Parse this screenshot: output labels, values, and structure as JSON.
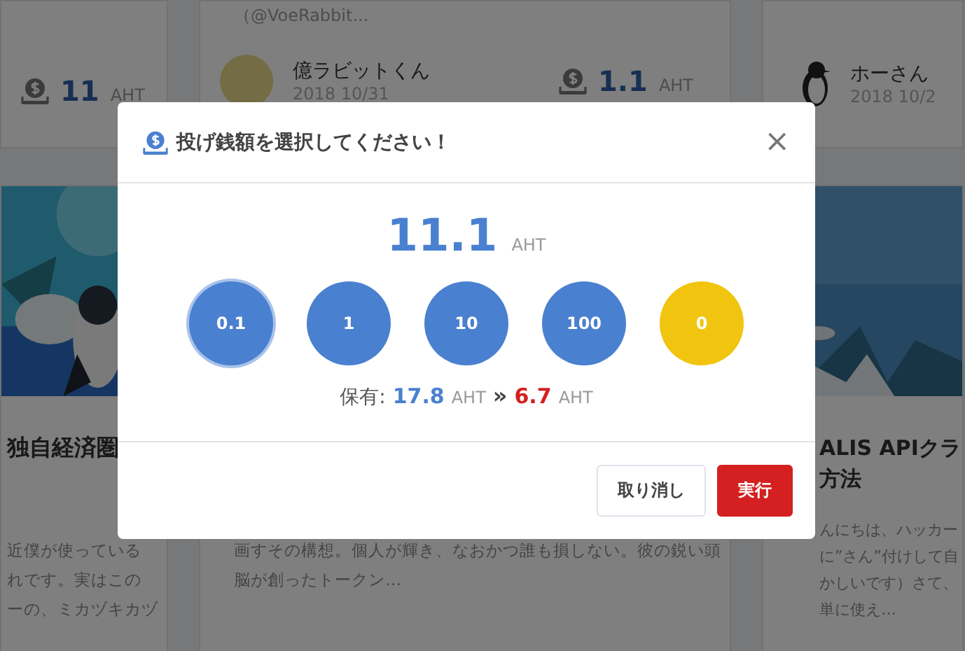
{
  "background": {
    "top_row": [
      {
        "tip": {
          "amount": "11",
          "unit": "AHT"
        }
      },
      {
        "handle": "（@VoeRabbit...",
        "author": {
          "name": "億ラビットくん",
          "date": "2018 10/31"
        },
        "tip": {
          "amount": "1.1",
          "unit": "AHT"
        }
      },
      {
        "author": {
          "name": "ホーさん",
          "date": "2018 10/2"
        }
      }
    ],
    "lower_row": [
      {
        "title_lines": [
          "独自経済圏"
        ],
        "excerpt_lines": [
          "近僕が使っている",
          "れです。実はこの",
          "ーの、ミカヅキカヅ"
        ]
      },
      {
        "excerpt_lines": [
          "画すその構想。個人が輝き、なおかつ誰も損しない。彼の鋭い頭",
          "脳が創ったトークン…"
        ]
      },
      {
        "title_lines": [
          "ALIS APIクラ",
          "方法"
        ],
        "excerpt_lines": [
          "んにちは、ハッカー",
          "に”さん”付けして自",
          "かしいです）さて、",
          "単に使え…"
        ]
      }
    ]
  },
  "modal": {
    "title": "投げ銭額を選択してください！",
    "close": "×",
    "amount": "11.1",
    "unit": "AHT",
    "chips": [
      {
        "label": "0.1",
        "kind": "amount",
        "selected": true
      },
      {
        "label": "1",
        "kind": "amount",
        "selected": false
      },
      {
        "label": "10",
        "kind": "amount",
        "selected": false
      },
      {
        "label": "100",
        "kind": "amount",
        "selected": false
      },
      {
        "label": "0",
        "kind": "reset",
        "selected": false
      }
    ],
    "balance": {
      "label": "保有:",
      "current": "17.8",
      "current_unit": "AHT",
      "arrow": "»",
      "after": "6.7",
      "after_unit": "AHT"
    },
    "buttons": [
      {
        "label": "取り消し",
        "kind": "secondary"
      },
      {
        "label": "実行",
        "kind": "primary"
      }
    ]
  }
}
